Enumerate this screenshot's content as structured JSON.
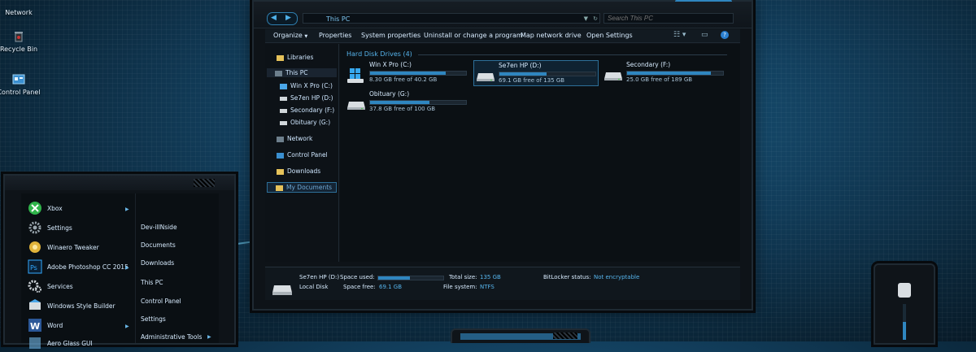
{
  "desktop": {
    "icons": [
      {
        "label": "Network",
        "icon": "network-icon"
      },
      {
        "label": "Recycle Bin",
        "icon": "recycle-bin-icon"
      },
      {
        "label": "Control Panel",
        "icon": "control-panel-icon"
      }
    ]
  },
  "explorer": {
    "address": "This PC",
    "search_placeholder": "Search This PC",
    "toolbar": {
      "organize": "Organize",
      "properties": "Properties",
      "system_properties": "System properties",
      "uninstall": "Uninstall or change a program",
      "map_network_drive": "Map network drive",
      "open_settings": "Open Settings"
    },
    "nav": {
      "libraries": "Libraries",
      "this_pc": "This PC",
      "drive_c": "Win X Pro (C:)",
      "drive_d": "Se7en HP (D:)",
      "drive_f": "Secondary (F:)",
      "drive_g": "Obituary (G:)",
      "network": "Network",
      "control_panel": "Control Panel",
      "downloads": "Downloads",
      "my_documents": "My Documents"
    },
    "group_title": "Hard Disk Drives (4)",
    "drives": [
      {
        "name": "Win X Pro (C:)",
        "free": "8.30 GB free of 40.2 GB",
        "used_fraction": 0.79,
        "type": "windows"
      },
      {
        "name": "Se7en HP (D:)",
        "free": "69.1 GB free of 135 GB",
        "used_fraction": 0.49,
        "type": "hdd",
        "selected": true
      },
      {
        "name": "Secondary (F:)",
        "free": "25.0 GB free of 189 GB",
        "used_fraction": 0.87,
        "type": "hdd"
      },
      {
        "name": "Obituary (G:)",
        "free": "37.8 GB free of 100 GB",
        "used_fraction": 0.62,
        "type": "hdd"
      }
    ],
    "details": {
      "drive_name": "Se7en HP (D:)",
      "drive_type": "Local Disk",
      "space_used_label": "Space used:",
      "space_used_fraction": 0.49,
      "space_free_label": "Space free:",
      "space_free_value": "69.1 GB",
      "total_size_label": "Total size:",
      "total_size_value": "135 GB",
      "file_system_label": "File system:",
      "file_system_value": "NTFS",
      "bitlocker_label": "BitLocker status:",
      "bitlocker_value": "Not encryptable"
    }
  },
  "start_menu": {
    "left_items": [
      {
        "label": "Xbox",
        "has_arrow": true
      },
      {
        "label": "Settings",
        "has_arrow": false
      },
      {
        "label": "Winaero Tweaker",
        "has_arrow": false
      },
      {
        "label": "Adobe Photoshop CC 2015",
        "has_arrow": true
      },
      {
        "label": "Services",
        "has_arrow": false
      },
      {
        "label": "Windows Style Builder",
        "has_arrow": false
      },
      {
        "label": "Word",
        "has_arrow": true
      },
      {
        "label": "Aero Glass GUI",
        "has_arrow": false
      }
    ],
    "right_items": [
      {
        "label": "Dev-illNside",
        "has_arrow": false
      },
      {
        "label": "Documents",
        "has_arrow": false
      },
      {
        "label": "Downloads",
        "has_arrow": false
      },
      {
        "label": "This PC",
        "has_arrow": false
      },
      {
        "label": "Control Panel",
        "has_arrow": false
      },
      {
        "label": "Settings",
        "has_arrow": false
      },
      {
        "label": "Administrative Tools",
        "has_arrow": true
      }
    ]
  },
  "colors": {
    "accent": "#2f86c0",
    "accent_text": "#56b4ec",
    "window_bg": "#0e1318"
  }
}
